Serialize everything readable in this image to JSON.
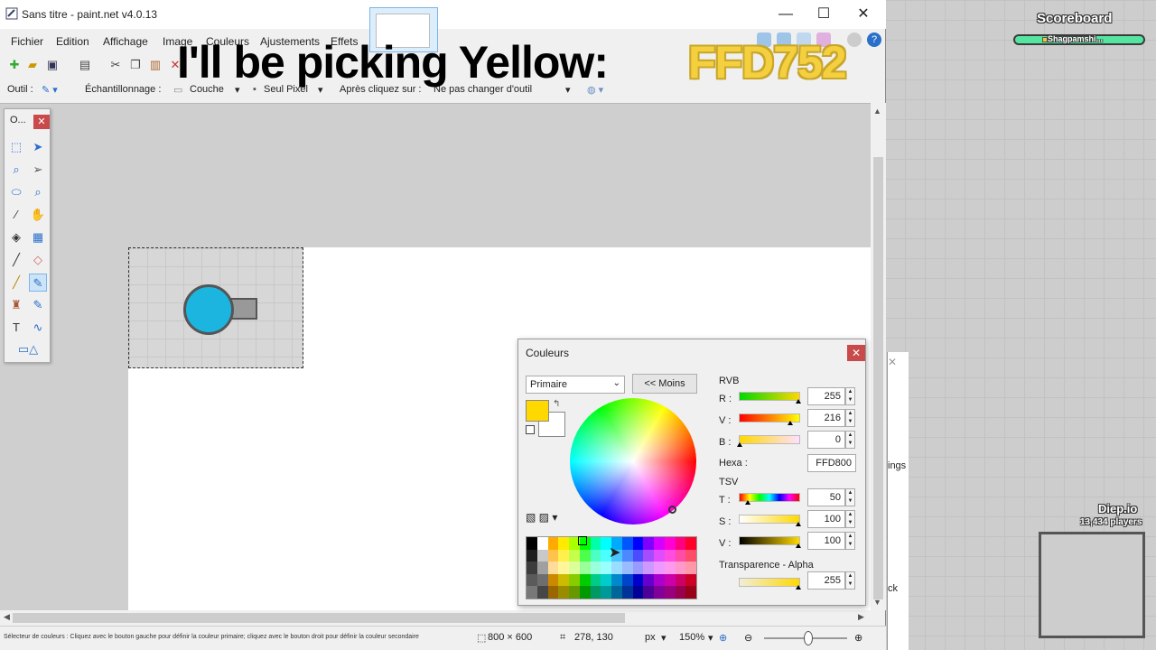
{
  "window": {
    "title": "Sans titre - paint.net v4.0.13"
  },
  "menu": [
    "Fichier",
    "Edition",
    "Affichage",
    "Image",
    "Couleurs",
    "Ajustements",
    "Effets"
  ],
  "toolbar2": {
    "tool_label": "Outil :",
    "sampling_label": "Échantillonnage :",
    "layer_value": "Couche",
    "pixel_value": "Seul Pixel",
    "after_click_label": "Après cliquez sur :",
    "after_click_value": "Ne pas changer d'outil"
  },
  "caption": {
    "text": "I'll be picking Yellow:",
    "hex": "FFD752"
  },
  "tools_panel": {
    "title": "O..."
  },
  "colors_dialog": {
    "title": "Couleurs",
    "dropdown": "Primaire",
    "less_button": "<< Moins",
    "rvb_label": "RVB",
    "r_label": "R :",
    "r_value": "255",
    "v_label": "V :",
    "v_value": "216",
    "b_label": "B :",
    "b_value": "0",
    "hex_label": "Hexa :",
    "hex_value": "FFD800",
    "tsv_label": "TSV",
    "t_label": "T :",
    "t_value": "50",
    "s_label": "S :",
    "s_value": "100",
    "v2_label": "V :",
    "v2_value": "100",
    "alpha_label": "Transparence - Alpha",
    "alpha_value": "255",
    "primary_color": "#ffd800"
  },
  "status": {
    "hint": "Sélecteur de couleurs : Cliquez avec le bouton gauche pour définir la couleur primaire; cliquez avec le bouton droit pour définir la couleur secondaire",
    "size": "800 × 600",
    "coords": "278, 130",
    "unit": "px",
    "zoom": "150%"
  },
  "game": {
    "scoreboard_title": "Scoreboard",
    "scoreboard_entry": "Shagpamshi...",
    "site": "Diep.io",
    "players": "13,434 players",
    "partial_text_1": "ings",
    "partial_text_2": "ck"
  }
}
